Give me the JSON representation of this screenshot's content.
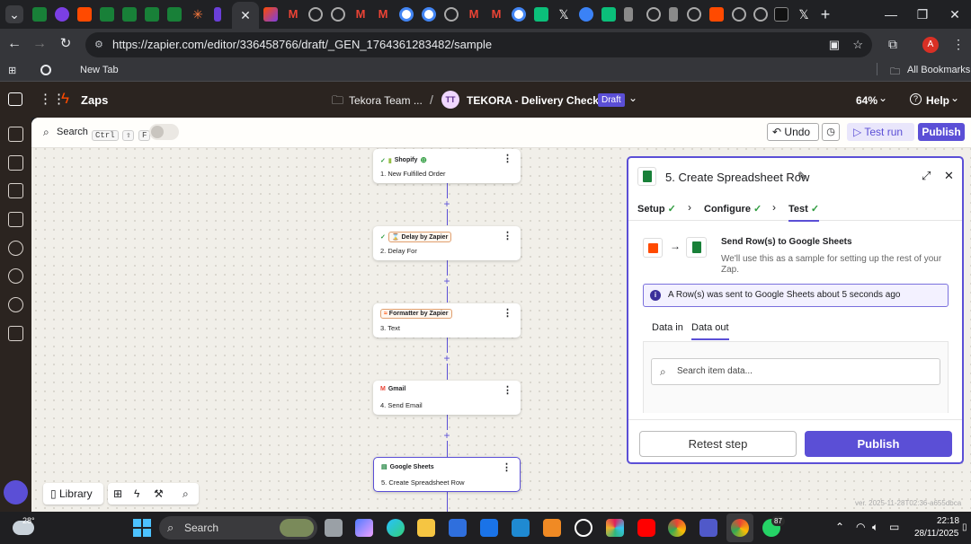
{
  "browser": {
    "url": "https://zapier.com/editor/336458766/draft/_GEN_1764361283482/sample",
    "bookmarks": {
      "new_tab": "New Tab",
      "all_bookmarks": "All Bookmarks"
    },
    "profile_initial": "A",
    "tab_close_glyph": "✕",
    "new_tab_glyph": "+"
  },
  "header": {
    "app_name": "Zaps",
    "folder": "Tekora Team ...",
    "separator": "/",
    "avatar_initials": "TT",
    "zap_title": "TEKORA - Delivery Check-In",
    "status_badge": "Draft",
    "zoom": "64%",
    "help": "Help"
  },
  "toolbar": {
    "search_label": "Search",
    "search_shortcut": [
      "Ctrl",
      "⇧",
      "F"
    ],
    "undo_label": "Undo",
    "test_run_label": "Test run",
    "publish_label": "Publish"
  },
  "steps": [
    {
      "app": "Shopify",
      "title": "1. New Fulfilled Order"
    },
    {
      "app": "Delay by Zapier",
      "title": "2. Delay For"
    },
    {
      "app": "Formatter by Zapier",
      "title": "3. Text"
    },
    {
      "app": "Gmail",
      "title": "4. Send Email"
    },
    {
      "app": "Google Sheets",
      "title": "5. Create Spreadsheet Row"
    }
  ],
  "panel": {
    "title": "5. Create Spreadsheet Row",
    "tabs": [
      {
        "label": "Setup",
        "done": true
      },
      {
        "label": "Configure",
        "done": true
      },
      {
        "label": "Test",
        "done": true
      }
    ],
    "send_title": "Send Row(s) to Google Sheets",
    "send_desc": "We'll use this as a sample for setting up the rest of your Zap.",
    "info": "A Row(s) was sent to Google Sheets about 5 seconds ago",
    "data_tabs": [
      "Data in",
      "Data out"
    ],
    "search_placeholder": "Search item data...",
    "retest": "Retest step",
    "publish": "Publish"
  },
  "bottom_bar": {
    "library": "Library"
  },
  "version": "ver. 2025-11-28T02:36-a655dbca",
  "taskbar": {
    "weather_temp": "28°",
    "search": "Search",
    "time": "22:18",
    "date": "28/11/2025",
    "whatsapp_badge": "87"
  },
  "colors": {
    "accent": "#5b4fd6",
    "zapier_orange": "#ff4a00",
    "sheets_green": "#188038",
    "header_bg": "#2b2420"
  }
}
